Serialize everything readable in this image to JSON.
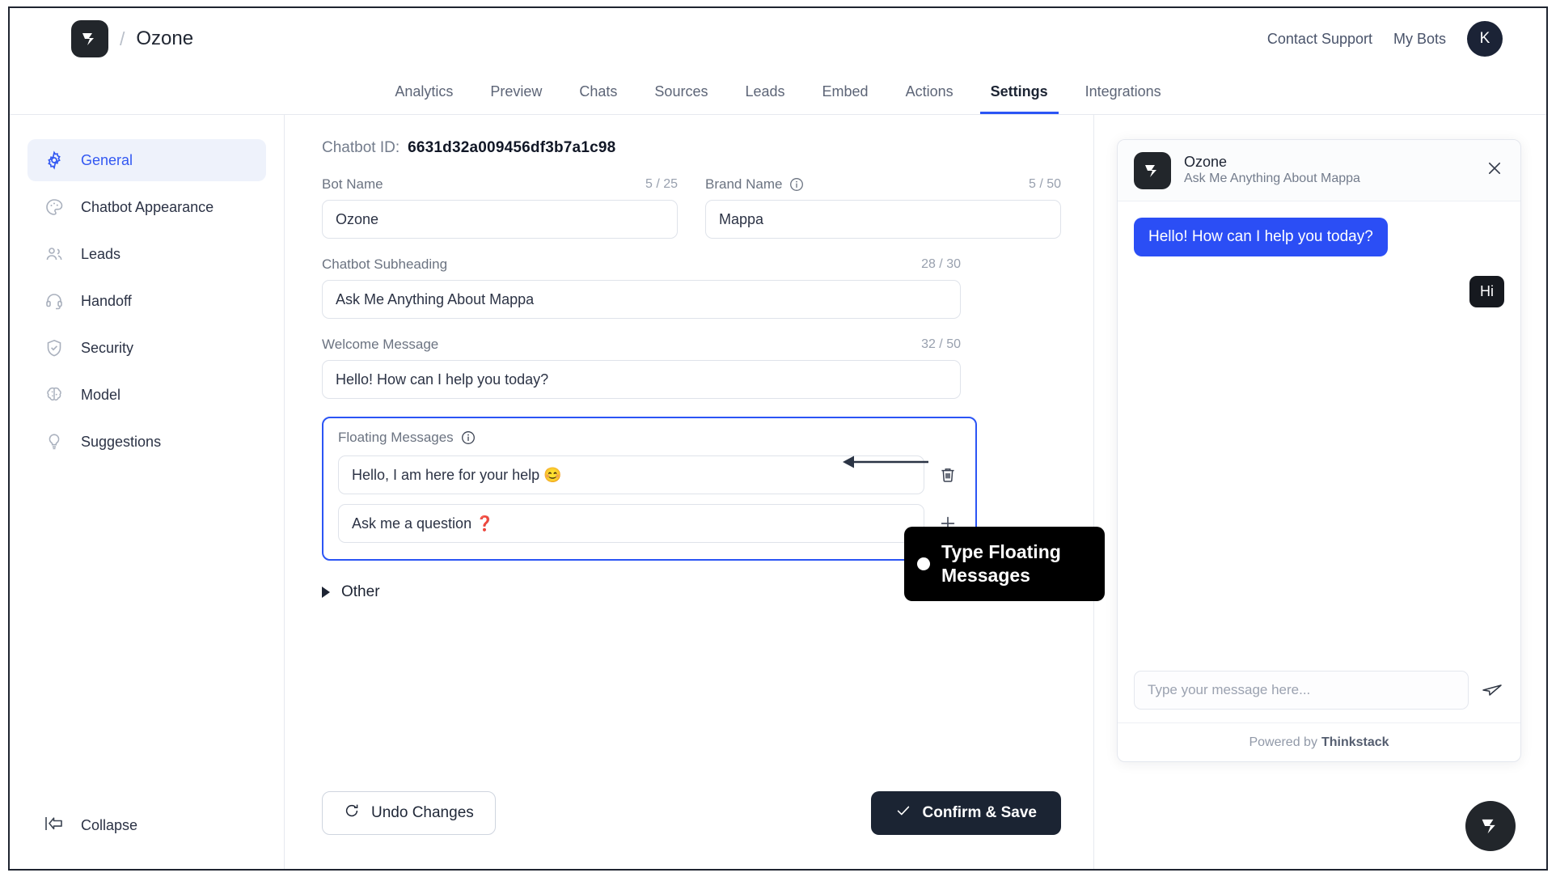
{
  "header": {
    "brand_separator": "/",
    "brand_name": "Ozone",
    "contact_support": "Contact Support",
    "my_bots": "My Bots",
    "avatar_initial": "K"
  },
  "tabs": [
    {
      "label": "Analytics",
      "active": false
    },
    {
      "label": "Preview",
      "active": false
    },
    {
      "label": "Chats",
      "active": false
    },
    {
      "label": "Sources",
      "active": false
    },
    {
      "label": "Leads",
      "active": false
    },
    {
      "label": "Embed",
      "active": false
    },
    {
      "label": "Actions",
      "active": false
    },
    {
      "label": "Settings",
      "active": true
    },
    {
      "label": "Integrations",
      "active": false
    }
  ],
  "sidebar": {
    "items": [
      {
        "label": "General",
        "icon": "gear-icon",
        "active": true
      },
      {
        "label": "Chatbot Appearance",
        "icon": "palette-icon",
        "active": false
      },
      {
        "label": "Leads",
        "icon": "users-icon",
        "active": false
      },
      {
        "label": "Handoff",
        "icon": "headset-icon",
        "active": false
      },
      {
        "label": "Security",
        "icon": "shield-check-icon",
        "active": false
      },
      {
        "label": "Model",
        "icon": "brain-icon",
        "active": false
      },
      {
        "label": "Suggestions",
        "icon": "lightbulb-icon",
        "active": false
      }
    ],
    "collapse_label": "Collapse"
  },
  "settings": {
    "chatbot_id_label": "Chatbot ID:",
    "chatbot_id_value": "6631d32a009456df3b7a1c98",
    "bot_name": {
      "label": "Bot Name",
      "counter": "5 / 25",
      "value": "Ozone"
    },
    "brand_name": {
      "label": "Brand Name",
      "counter": "5 / 50",
      "value": "Mappa"
    },
    "subheading": {
      "label": "Chatbot Subheading",
      "counter": "28 / 30",
      "value": "Ask Me Anything About Mappa"
    },
    "welcome_message": {
      "label": "Welcome Message",
      "counter": "32 / 50",
      "value": "Hello! How can I help you today?"
    },
    "floating_messages": {
      "label": "Floating Messages",
      "items": [
        {
          "value": "Hello, I am here for your help 😊",
          "action": "delete"
        },
        {
          "value": "Ask me a question ❓",
          "action": "add"
        }
      ]
    },
    "other_section_label": "Other",
    "undo_label": "Undo Changes",
    "save_label": "Confirm & Save"
  },
  "preview": {
    "title": "Ozone",
    "subtitle": "Ask Me Anything About Mappa",
    "bot_message": "Hello! How can I help you today?",
    "user_message": "Hi",
    "input_placeholder": "Type your message here...",
    "footer_prefix": "Powered by",
    "footer_brand": "Thinkstack"
  },
  "annotation": {
    "callout_text": "Type Floating Messages"
  },
  "colors": {
    "accent_blue": "#2b55f5",
    "bubble_blue": "#2b4ef5",
    "dark": "#1b2433",
    "callout_black": "#000000"
  }
}
